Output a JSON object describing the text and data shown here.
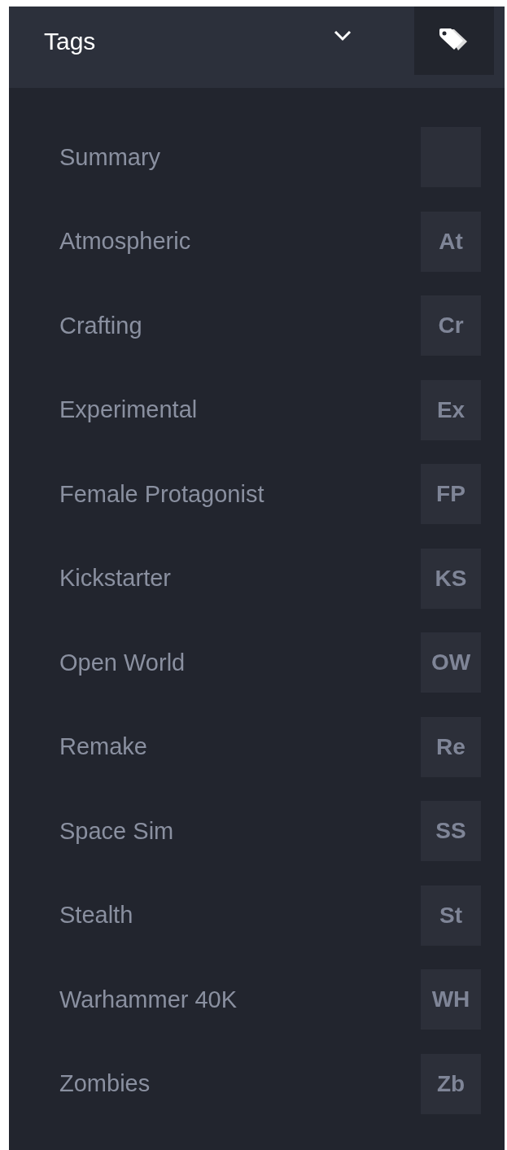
{
  "header": {
    "title": "Tags"
  },
  "tags": [
    {
      "name": "Summary"
    },
    {
      "name": "Atmospheric",
      "abbr": "At"
    },
    {
      "name": "Crafting",
      "abbr": "Cr"
    },
    {
      "name": "Experimental",
      "abbr": "Ex"
    },
    {
      "name": "Female Protagonist",
      "abbr": "FP"
    },
    {
      "name": "Kickstarter",
      "abbr": "KS"
    },
    {
      "name": "Open World",
      "abbr": "OW"
    },
    {
      "name": "Remake",
      "abbr": "Re"
    },
    {
      "name": "Space Sim",
      "abbr": "SS"
    },
    {
      "name": "Stealth",
      "abbr": "St"
    },
    {
      "name": "Warhammer 40K",
      "abbr": "WH"
    },
    {
      "name": "Zombies",
      "abbr": "Zb"
    }
  ]
}
